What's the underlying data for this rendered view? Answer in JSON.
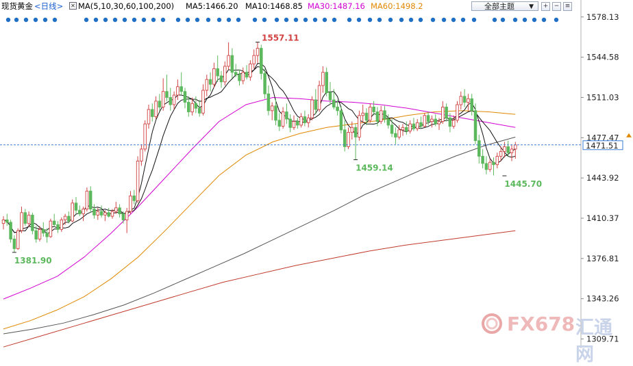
{
  "header": {
    "symbol": "现货黄金",
    "period": "<日线>",
    "ma_list": "MA(5,10,30,60,100,200)",
    "ma5": "MA5:1466.20",
    "ma10": "MA10:1468.85",
    "ma30": "MA30:1487.16",
    "ma60": "MA60:1498.2",
    "topic_select": "全部主题",
    "colors": {
      "ma5": "#111111",
      "ma10": "#111111",
      "ma30": "#d200d2",
      "ma60": "#e08800",
      "ma100": "#555555",
      "ma200": "#c0392b",
      "up": "#d14242",
      "down": "#5cb85c"
    }
  },
  "watermark": {
    "brand": "FX678",
    "cn": "汇通网"
  },
  "current_price": {
    "label": "1471.51",
    "value": 1471.51
  },
  "chart_data": {
    "type": "candlestick",
    "ylim": [
      1302,
      1582
    ],
    "yticks": [
      "1578.13",
      "1544.58",
      "1511.03",
      "1477.47",
      "1443.92",
      "1410.37",
      "1376.81",
      "1343.26",
      "1309.71"
    ],
    "ytick_values": [
      1578.13,
      1544.58,
      1511.03,
      1477.47,
      1443.92,
      1410.37,
      1376.81,
      1343.26,
      1309.71
    ],
    "annotations": [
      {
        "text": "1557.11",
        "index": 70,
        "value": 1557.11,
        "color": "#d14242"
      },
      {
        "text": "1459.14",
        "index": 97,
        "value": 1459.14,
        "color": "#5cb85c"
      },
      {
        "text": "1445.70",
        "index": 138,
        "value": 1445.7,
        "color": "#5cb85c"
      },
      {
        "text": "1381.90",
        "index": 3,
        "value": 1381.9,
        "color": "#5cb85c"
      }
    ],
    "candles": [
      [
        1406,
        1412,
        1401,
        1409
      ],
      [
        1409,
        1414,
        1404,
        1407
      ],
      [
        1407,
        1409,
        1390,
        1393
      ],
      [
        1393,
        1396,
        1382,
        1385
      ],
      [
        1385,
        1402,
        1384,
        1400
      ],
      [
        1400,
        1420,
        1398,
        1415
      ],
      [
        1415,
        1418,
        1404,
        1406
      ],
      [
        1406,
        1416,
        1403,
        1413
      ],
      [
        1413,
        1415,
        1397,
        1400
      ],
      [
        1400,
        1404,
        1390,
        1393
      ],
      [
        1393,
        1404,
        1391,
        1401
      ],
      [
        1401,
        1407,
        1395,
        1398
      ],
      [
        1398,
        1402,
        1390,
        1395
      ],
      [
        1395,
        1410,
        1394,
        1408
      ],
      [
        1408,
        1414,
        1403,
        1405
      ],
      [
        1405,
        1408,
        1398,
        1401
      ],
      [
        1401,
        1411,
        1399,
        1409
      ],
      [
        1409,
        1414,
        1405,
        1412
      ],
      [
        1412,
        1416,
        1406,
        1408
      ],
      [
        1408,
        1426,
        1407,
        1423
      ],
      [
        1423,
        1428,
        1414,
        1417
      ],
      [
        1417,
        1421,
        1412,
        1414
      ],
      [
        1414,
        1420,
        1408,
        1418
      ],
      [
        1418,
        1436,
        1416,
        1433
      ],
      [
        1433,
        1437,
        1415,
        1418
      ],
      [
        1418,
        1422,
        1410,
        1413
      ],
      [
        1413,
        1419,
        1409,
        1416
      ],
      [
        1416,
        1421,
        1411,
        1413
      ],
      [
        1413,
        1417,
        1408,
        1415
      ],
      [
        1415,
        1419,
        1411,
        1412
      ],
      [
        1412,
        1418,
        1410,
        1416
      ],
      [
        1416,
        1424,
        1414,
        1419
      ],
      [
        1419,
        1422,
        1411,
        1414
      ],
      [
        1414,
        1416,
        1406,
        1409
      ],
      [
        1409,
        1419,
        1398,
        1416
      ],
      [
        1416,
        1433,
        1414,
        1429
      ],
      [
        1429,
        1434,
        1422,
        1425
      ],
      [
        1425,
        1462,
        1423,
        1458
      ],
      [
        1458,
        1472,
        1454,
        1468
      ],
      [
        1468,
        1492,
        1466,
        1489
      ],
      [
        1489,
        1505,
        1485,
        1501
      ],
      [
        1501,
        1506,
        1491,
        1495
      ],
      [
        1495,
        1512,
        1493,
        1508
      ],
      [
        1508,
        1514,
        1500,
        1503
      ],
      [
        1503,
        1527,
        1500,
        1516
      ],
      [
        1516,
        1530,
        1508,
        1511
      ],
      [
        1511,
        1519,
        1500,
        1505
      ],
      [
        1505,
        1516,
        1501,
        1513
      ],
      [
        1513,
        1526,
        1509,
        1520
      ],
      [
        1520,
        1532,
        1513,
        1516
      ],
      [
        1516,
        1519,
        1502,
        1507
      ],
      [
        1507,
        1512,
        1495,
        1499
      ],
      [
        1499,
        1511,
        1496,
        1506
      ],
      [
        1506,
        1512,
        1498,
        1502
      ],
      [
        1502,
        1509,
        1495,
        1498
      ],
      [
        1498,
        1522,
        1496,
        1517
      ],
      [
        1517,
        1530,
        1512,
        1526
      ],
      [
        1526,
        1532,
        1516,
        1522
      ],
      [
        1522,
        1540,
        1519,
        1535
      ],
      [
        1535,
        1546,
        1524,
        1529
      ],
      [
        1529,
        1533,
        1519,
        1524
      ],
      [
        1524,
        1541,
        1521,
        1537
      ],
      [
        1537,
        1557,
        1534,
        1546
      ],
      [
        1546,
        1552,
        1527,
        1532
      ],
      [
        1532,
        1539,
        1528,
        1530
      ],
      [
        1530,
        1534,
        1521,
        1525
      ],
      [
        1525,
        1536,
        1522,
        1532
      ],
      [
        1532,
        1538,
        1526,
        1528
      ],
      [
        1528,
        1542,
        1525,
        1539
      ],
      [
        1539,
        1551,
        1535,
        1546
      ],
      [
        1546,
        1557,
        1540,
        1552
      ],
      [
        1552,
        1555,
        1526,
        1531
      ],
      [
        1531,
        1535,
        1510,
        1514
      ],
      [
        1514,
        1521,
        1496,
        1500
      ],
      [
        1500,
        1507,
        1492,
        1504
      ],
      [
        1504,
        1510,
        1488,
        1492
      ],
      [
        1492,
        1498,
        1483,
        1487
      ],
      [
        1487,
        1503,
        1485,
        1499
      ],
      [
        1499,
        1506,
        1489,
        1493
      ],
      [
        1493,
        1497,
        1482,
        1486
      ],
      [
        1486,
        1496,
        1484,
        1491
      ],
      [
        1491,
        1494,
        1485,
        1488
      ],
      [
        1488,
        1498,
        1486,
        1495
      ],
      [
        1495,
        1500,
        1487,
        1490
      ],
      [
        1490,
        1497,
        1486,
        1494
      ],
      [
        1494,
        1512,
        1492,
        1509
      ],
      [
        1509,
        1518,
        1497,
        1501
      ],
      [
        1501,
        1525,
        1499,
        1521
      ],
      [
        1521,
        1537,
        1515,
        1532
      ],
      [
        1532,
        1536,
        1512,
        1515
      ],
      [
        1515,
        1524,
        1505,
        1509
      ],
      [
        1509,
        1518,
        1501,
        1503
      ],
      [
        1503,
        1509,
        1496,
        1500
      ],
      [
        1500,
        1504,
        1481,
        1484
      ],
      [
        1484,
        1492,
        1466,
        1470
      ],
      [
        1470,
        1486,
        1468,
        1482
      ],
      [
        1482,
        1491,
        1476,
        1486
      ],
      [
        1486,
        1489,
        1459,
        1478
      ],
      [
        1478,
        1500,
        1475,
        1496
      ],
      [
        1496,
        1505,
        1490,
        1498
      ],
      [
        1498,
        1502,
        1488,
        1492
      ],
      [
        1492,
        1506,
        1490,
        1503
      ],
      [
        1503,
        1508,
        1496,
        1499
      ],
      [
        1499,
        1503,
        1487,
        1491
      ],
      [
        1491,
        1504,
        1489,
        1500
      ],
      [
        1500,
        1504,
        1490,
        1493
      ],
      [
        1493,
        1497,
        1485,
        1488
      ],
      [
        1488,
        1493,
        1478,
        1481
      ],
      [
        1481,
        1486,
        1472,
        1478
      ],
      [
        1478,
        1488,
        1476,
        1484
      ],
      [
        1484,
        1489,
        1479,
        1486
      ],
      [
        1486,
        1491,
        1480,
        1483
      ],
      [
        1483,
        1492,
        1481,
        1489
      ],
      [
        1489,
        1494,
        1483,
        1485
      ],
      [
        1485,
        1493,
        1483,
        1490
      ],
      [
        1490,
        1495,
        1485,
        1487
      ],
      [
        1487,
        1498,
        1486,
        1496
      ],
      [
        1496,
        1499,
        1488,
        1491
      ],
      [
        1491,
        1496,
        1486,
        1493
      ],
      [
        1493,
        1497,
        1487,
        1489
      ],
      [
        1489,
        1494,
        1484,
        1491
      ],
      [
        1491,
        1508,
        1489,
        1503
      ],
      [
        1503,
        1506,
        1491,
        1494
      ],
      [
        1494,
        1498,
        1482,
        1487
      ],
      [
        1487,
        1496,
        1485,
        1492
      ],
      [
        1492,
        1508,
        1490,
        1505
      ],
      [
        1505,
        1516,
        1501,
        1512
      ],
      [
        1512,
        1518,
        1503,
        1507
      ],
      [
        1507,
        1514,
        1500,
        1510
      ],
      [
        1510,
        1514,
        1496,
        1500
      ],
      [
        1500,
        1506,
        1472,
        1475
      ],
      [
        1475,
        1480,
        1456,
        1462
      ],
      [
        1462,
        1468,
        1452,
        1456
      ],
      [
        1456,
        1462,
        1447,
        1451
      ],
      [
        1451,
        1460,
        1449,
        1457
      ],
      [
        1457,
        1461,
        1446,
        1455
      ],
      [
        1455,
        1465,
        1452,
        1462
      ],
      [
        1462,
        1470,
        1458,
        1466
      ],
      [
        1466,
        1474,
        1461,
        1470
      ],
      [
        1470,
        1475,
        1462,
        1465
      ],
      [
        1465,
        1472,
        1458,
        1468
      ],
      [
        1468,
        1474,
        1460,
        1471.5
      ]
    ]
  }
}
